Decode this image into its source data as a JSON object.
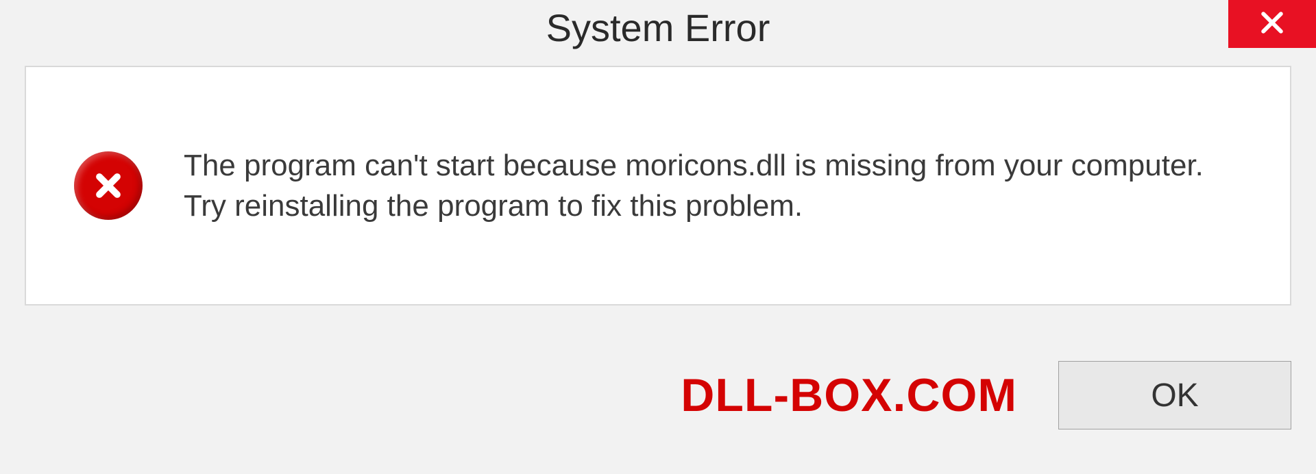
{
  "dialog": {
    "title": "System Error",
    "message": "The program can't start because moricons.dll is missing from your computer. Try reinstalling the program to fix this problem.",
    "ok_label": "OK"
  },
  "watermark": "DLL-BOX.COM",
  "icons": {
    "close": "close-icon",
    "error": "error-circle-icon"
  },
  "colors": {
    "accent_red": "#e81123",
    "error_red": "#d40303",
    "bg": "#f2f2f2",
    "panel": "#ffffff"
  }
}
